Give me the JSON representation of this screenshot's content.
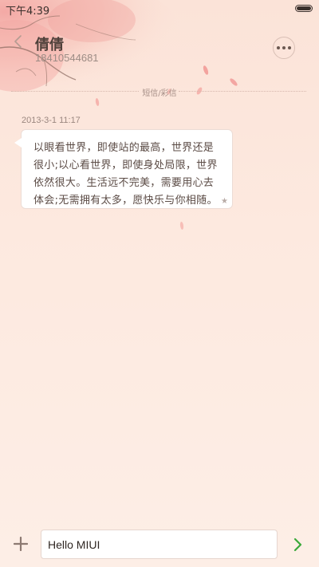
{
  "status_bar": {
    "time": "下午4:39",
    "battery_level": 1.0
  },
  "header": {
    "contact_name": "倩倩",
    "contact_number": "18410544681",
    "icons": {
      "back": "chevron-left-icon",
      "more": "more-dots-icon"
    }
  },
  "divider": {
    "label": "短信/彩信"
  },
  "messages": [
    {
      "timestamp": "2013-3-1 11:17",
      "text": "以眼看世界，即使站的最高，世界还是很小;以心看世界，即使身处局限，世界依然很大。生活远不完美，需要用心去体会;无需拥有太多，愿快乐与你相随。",
      "star_icon": "star-icon"
    }
  ],
  "composer": {
    "value": "Hello MIUI",
    "add_icon": "plus-icon",
    "send_icon": "send-chevron-icon"
  },
  "colors": {
    "accent_send": "#3aa83a",
    "background": "#fde9df",
    "bubble": "#ffffff"
  }
}
